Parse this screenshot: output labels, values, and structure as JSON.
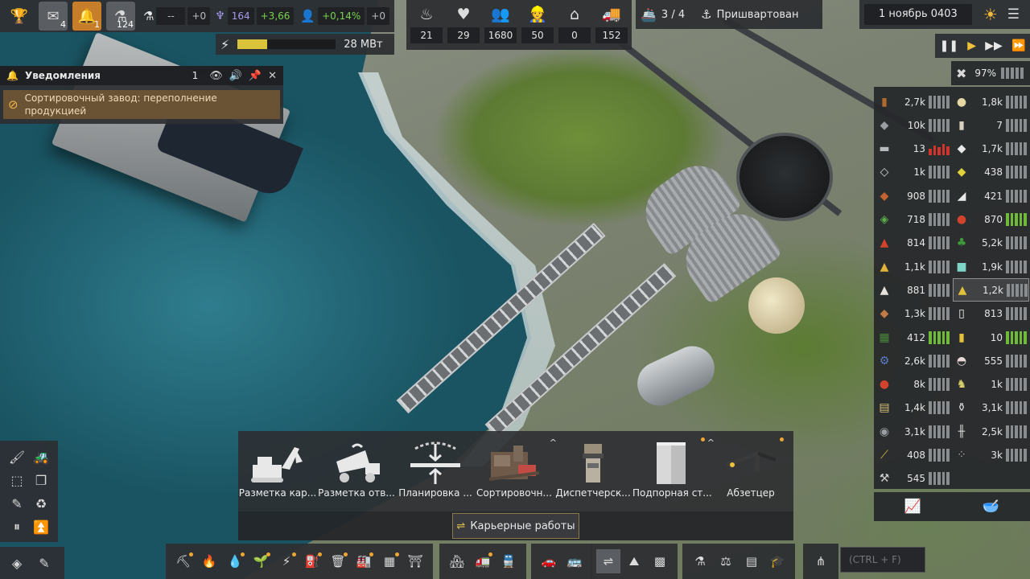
{
  "top_left": {
    "buttons": [
      {
        "name": "trophy",
        "icon": "trophy-icon",
        "glyph": "🏆"
      },
      {
        "name": "mail",
        "icon": "mail-icon",
        "glyph": "✉",
        "badge": "4"
      },
      {
        "name": "alerts",
        "icon": "bell-icon",
        "glyph": "🔔",
        "badge": "1"
      },
      {
        "name": "research",
        "icon": "flask-icon",
        "glyph": "⚗",
        "badge": "124"
      }
    ],
    "research_label": "--",
    "research_delta": "+0",
    "unity_value": "164",
    "unity_delta": "+3,66",
    "pop_growth": "+0,14%",
    "pop_delta": "+0"
  },
  "power": {
    "fill": 0.3,
    "value": "28 МВт"
  },
  "top_stats": [
    {
      "icon": "food-icon",
      "glyph": "♨",
      "value": "21"
    },
    {
      "icon": "health-icon",
      "glyph": "♥",
      "value": "29"
    },
    {
      "icon": "population-icon",
      "glyph": "👥",
      "value": "1680"
    },
    {
      "icon": "workers-icon",
      "glyph": "👷",
      "value": "50"
    },
    {
      "icon": "housing-icon",
      "glyph": "⌂",
      "value": "0"
    },
    {
      "icon": "vehicles-icon",
      "glyph": "🚚",
      "value": "152"
    }
  ],
  "ships": {
    "count": "3 / 4",
    "status": "Пришвартован"
  },
  "date": {
    "value": "1 ноябрь 0403"
  },
  "speed": {
    "buttons": [
      "pause",
      "play",
      "fast",
      "fastest"
    ]
  },
  "notifications": {
    "title": "Уведомления",
    "count": "1",
    "message": "Сортировочный завод: переполнение продукцией"
  },
  "utilization": {
    "value": "97%"
  },
  "resources_left": [
    {
      "icon": "wood-icon",
      "color": "#b06a2d",
      "value": "2,7k",
      "state": "normal"
    },
    {
      "icon": "iron-ore-icon",
      "color": "#9a9ea2",
      "value": "10k",
      "state": "normal"
    },
    {
      "icon": "steel-icon",
      "color": "#b8bbbe",
      "value": "13",
      "state": "alert"
    },
    {
      "icon": "concrete-icon",
      "color": "#d5d5d2",
      "value": "1k",
      "state": "normal"
    },
    {
      "icon": "copper-icon",
      "color": "#c4632f",
      "value": "908",
      "state": "normal"
    },
    {
      "icon": "mixed-ore-icon",
      "color": "#5ab04a",
      "value": "718",
      "state": "normal"
    },
    {
      "icon": "molten-icon",
      "color": "#d2432d",
      "value": "814",
      "state": "normal"
    },
    {
      "icon": "gold-icon",
      "color": "#e0b33a",
      "value": "1,1k",
      "state": "normal"
    },
    {
      "icon": "ingot-icon",
      "color": "#e5e2dc",
      "value": "881",
      "state": "normal"
    },
    {
      "icon": "bricks-icon",
      "color": "#c27a45",
      "value": "1,3k",
      "state": "normal"
    },
    {
      "icon": "chips-icon",
      "color": "#4a8a3a",
      "value": "412",
      "state": "good"
    },
    {
      "icon": "gear-icon",
      "color": "#5a7cc8",
      "value": "2,6k",
      "state": "normal"
    },
    {
      "icon": "fuel-icon",
      "color": "#d2432d",
      "value": "8k",
      "state": "normal"
    },
    {
      "icon": "crate-icon",
      "color": "#d8c07a",
      "value": "1,4k",
      "state": "normal"
    },
    {
      "icon": "gravel-icon",
      "color": "#9a9ea2",
      "value": "3,1k",
      "state": "normal"
    },
    {
      "icon": "pipe-icon",
      "color": "#e0c43a",
      "value": "408",
      "state": "normal"
    },
    {
      "icon": "wrench-icon",
      "color": "#cfcfcf",
      "value": "545",
      "state": "normal"
    }
  ],
  "resources_right": [
    {
      "icon": "grain-icon",
      "color": "#e3d8a4",
      "value": "1,8k",
      "state": "normal"
    },
    {
      "icon": "canned-food-icon",
      "color": "#d8d0c0",
      "value": "7",
      "state": "normal"
    },
    {
      "icon": "sugar-icon",
      "color": "#e8e8e8",
      "value": "1,7k",
      "state": "normal"
    },
    {
      "icon": "sulfur-icon",
      "color": "#e0d23a",
      "value": "438",
      "state": "normal"
    },
    {
      "icon": "salt-icon",
      "color": "#e8e8e8",
      "value": "421",
      "state": "normal"
    },
    {
      "icon": "tomato-icon",
      "color": "#d2432d",
      "value": "870",
      "state": "good"
    },
    {
      "icon": "plant-icon",
      "color": "#3f9a3a",
      "value": "5,2k",
      "state": "normal"
    },
    {
      "icon": "glass-icon",
      "color": "#7fd6c8",
      "value": "1,9k",
      "state": "normal"
    },
    {
      "icon": "sand-icon",
      "color": "#e0c23a",
      "value": "1,2k",
      "state": "hover"
    },
    {
      "icon": "paper-icon",
      "color": "#f0f0ec",
      "value": "813",
      "state": "normal"
    },
    {
      "icon": "battery-icon",
      "color": "#e3c23a",
      "value": "10",
      "state": "good"
    },
    {
      "icon": "meat-icon",
      "color": "#e8d8d8",
      "value": "555",
      "state": "normal"
    },
    {
      "icon": "animal-icon",
      "color": "#d8cf6a",
      "value": "1k",
      "state": "normal"
    },
    {
      "icon": "bottle-icon",
      "color": "#d8d8d8",
      "value": "3,1k",
      "state": "normal"
    },
    {
      "icon": "rail-icon",
      "color": "#cfcfcf",
      "value": "2,5k",
      "state": "normal"
    },
    {
      "icon": "rubble-icon",
      "color": "#aaaaaa",
      "value": "3k",
      "state": "normal"
    }
  ],
  "build_menu": {
    "items": [
      {
        "label": "Разметка кар...",
        "icon": "excavator-icon",
        "caret": false,
        "dot": false
      },
      {
        "label": "Разметка отв...",
        "icon": "dump-truck-icon",
        "caret": false,
        "dot": false
      },
      {
        "label": "Планировка ...",
        "icon": "leveling-icon",
        "caret": false,
        "dot": false
      },
      {
        "label": "Сортировочн...",
        "icon": "sorting-plant-icon",
        "caret": true,
        "dot": false
      },
      {
        "label": "Диспетчерск...",
        "icon": "control-tower-icon",
        "caret": false,
        "dot": false
      },
      {
        "label": "Подпорная ст...",
        "icon": "retaining-wall-icon",
        "caret": true,
        "dot": true
      },
      {
        "label": "Абзетцер",
        "icon": "stacker-icon",
        "caret": false,
        "dot": true
      }
    ],
    "active_tab": "Карьерные работы"
  },
  "left_tools": [
    {
      "icon": "brush-icon",
      "glyph": "🖌"
    },
    {
      "icon": "bulldozer-icon",
      "glyph": "🚜"
    },
    {
      "icon": "select-icon",
      "glyph": "⬚"
    },
    {
      "icon": "copy-icon",
      "glyph": "❐"
    },
    {
      "icon": "eyedropper-icon",
      "glyph": "✎"
    },
    {
      "icon": "recycle-icon",
      "glyph": "♻"
    },
    {
      "icon": "pause-building-icon",
      "glyph": "⏸"
    },
    {
      "icon": "priority-icon",
      "glyph": "⏫"
    }
  ],
  "left_bottom": [
    {
      "icon": "layers-icon",
      "glyph": "◈"
    },
    {
      "icon": "edit-icon",
      "glyph": "✎"
    }
  ],
  "bottom_groups": [
    [
      {
        "icon": "mining-icon",
        "glyph": "⛏",
        "dot": true
      },
      {
        "icon": "fire-icon",
        "glyph": "🔥",
        "dot": false
      },
      {
        "icon": "water-icon",
        "glyph": "💧",
        "dot": true
      },
      {
        "icon": "farm-icon",
        "glyph": "🌱",
        "dot": true
      },
      {
        "icon": "power-icon",
        "glyph": "⚡",
        "dot": true
      },
      {
        "icon": "tank-icon",
        "glyph": "⛽",
        "dot": true
      },
      {
        "icon": "trash-icon",
        "glyph": "🗑",
        "dot": true
      },
      {
        "icon": "factory-icon",
        "glyph": "🏭",
        "dot": true
      },
      {
        "icon": "warehouse-icon",
        "glyph": "▦",
        "dot": true
      },
      {
        "icon": "pillar-icon",
        "glyph": "⛩",
        "dot": false
      }
    ],
    [
      {
        "icon": "housing-build-icon",
        "glyph": "🏘",
        "dot": false
      },
      {
        "icon": "logistics-icon",
        "glyph": "🚛",
        "dot": true
      },
      {
        "icon": "train-icon",
        "glyph": "🚆",
        "dot": false
      }
    ],
    [
      {
        "icon": "car-icon",
        "glyph": "🚗",
        "dot": false
      },
      {
        "icon": "vehicle-depot-icon",
        "glyph": "🚌",
        "dot": false
      }
    ],
    [
      {
        "icon": "quarry-icon",
        "glyph": "⇌",
        "dot": false,
        "active": true
      },
      {
        "icon": "terrain-icon",
        "glyph": "⛰",
        "dot": false
      },
      {
        "icon": "grid-icon",
        "glyph": "▩",
        "dot": false
      }
    ],
    [
      {
        "icon": "lab-icon",
        "glyph": "⚗",
        "dot": false
      },
      {
        "icon": "balance-icon",
        "glyph": "⚖",
        "dot": false
      },
      {
        "icon": "document-icon",
        "glyph": "▤",
        "dot": false
      },
      {
        "icon": "education-icon",
        "glyph": "🎓",
        "dot": false
      }
    ],
    [
      {
        "icon": "tree-icon",
        "glyph": "⋔",
        "dot": false
      }
    ]
  ],
  "search": {
    "placeholder": "(CTRL + F)"
  }
}
